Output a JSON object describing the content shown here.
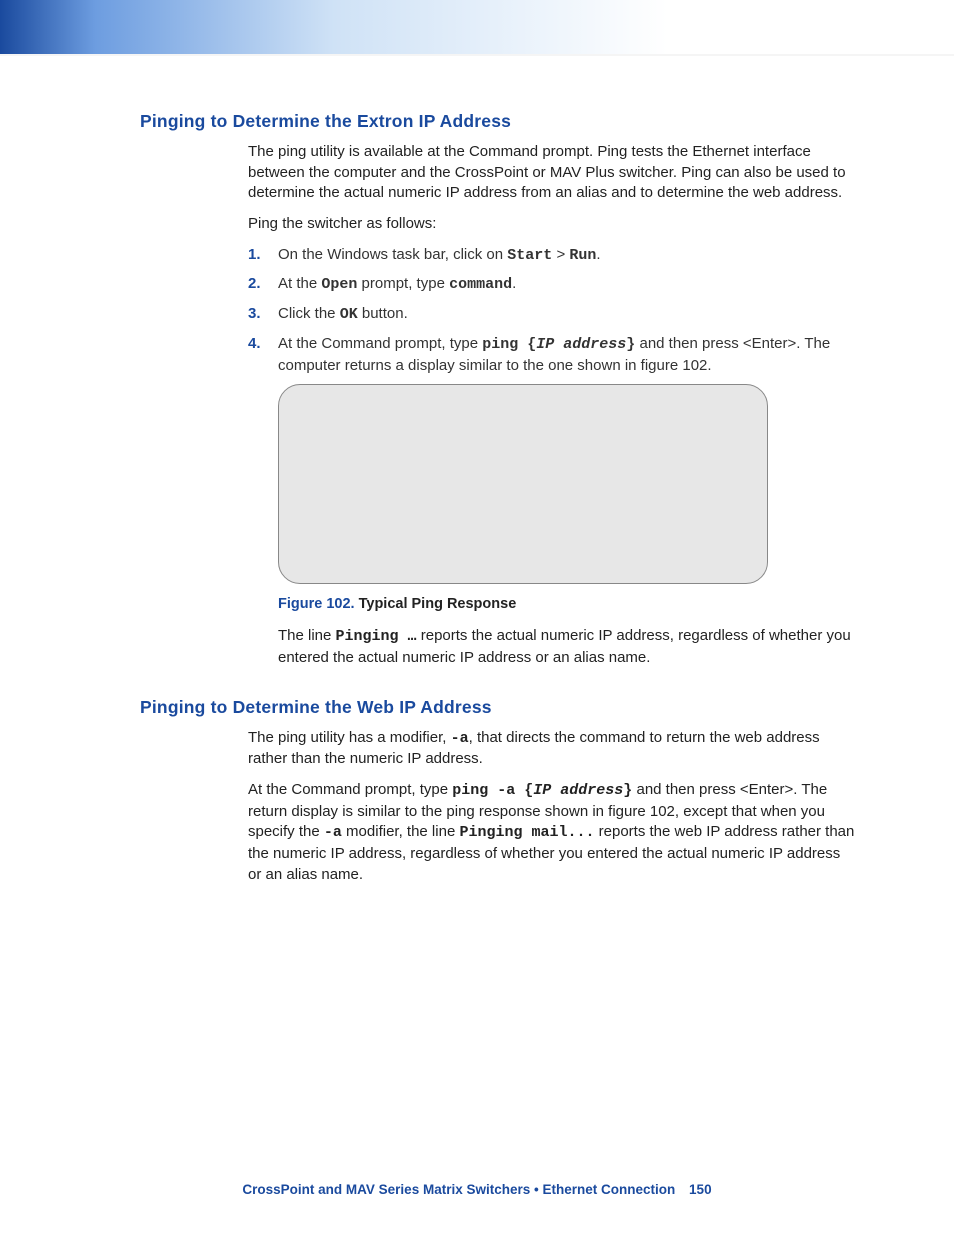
{
  "section1": {
    "heading": "Pinging to Determine the Extron IP Address",
    "intro": "The ping utility is available at the Command prompt. Ping tests the Ethernet interface between the computer and the CrossPoint or MAV Plus switcher. Ping can also be used to determine the actual numeric IP address from an alias and to determine the web address.",
    "lead": "Ping the switcher as follows:",
    "steps": {
      "s1": {
        "num": "1.",
        "pre": "On the Windows task bar, click on ",
        "code1": "Start",
        "mid": " > ",
        "code2": "Run",
        "post": "."
      },
      "s2": {
        "num": "2.",
        "pre": "At the ",
        "code1": "Open",
        "mid": " prompt, type ",
        "code2": "command",
        "post": "."
      },
      "s3": {
        "num": "3.",
        "pre": "Click the ",
        "code1": "OK",
        "post": " button."
      },
      "s4": {
        "num": "4.",
        "pre": "At the Command prompt, type ",
        "code1": "ping {",
        "codeit": "IP address",
        "code2": "}",
        "post": " and then press <Enter>. The computer returns a display similar to the one shown in figure 102."
      }
    },
    "figure": {
      "label": "Figure 102.",
      "title": "Typical Ping Response"
    },
    "after": {
      "pre": "The line ",
      "code": "Pinging …",
      "post": " reports the actual numeric IP address, regardless of whether you entered the actual numeric IP address or an alias name."
    }
  },
  "section2": {
    "heading": "Pinging to Determine the Web IP Address",
    "p1": {
      "pre": "The ping utility has a modifier, ",
      "code": "-a",
      "post": ", that directs the command to return the web address rather than the numeric IP address."
    },
    "p2": {
      "pre": "At the Command prompt, type ",
      "code1": "ping -a {",
      "codeit": "IP address",
      "code2": "}",
      "mid1": " and then press <Enter>. The return display is similar to the ping response shown in figure 102, except that when you specify the ",
      "code3": "-a",
      "mid2": " modifier, the line ",
      "code4": "Pinging mail...",
      "post": " reports the web IP address rather than the numeric IP address, regardless of whether you entered the actual numeric IP address or an alias name."
    }
  },
  "footer": {
    "product": "CrossPoint and MAV Series Matrix Switchers",
    "sep": "•",
    "section": "Ethernet Connection",
    "page": "150"
  }
}
